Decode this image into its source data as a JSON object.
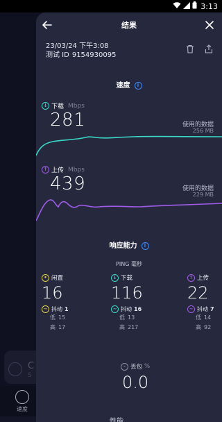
{
  "status_bar": {
    "time": "3:13"
  },
  "background_app": {
    "card_letter": "C",
    "card_sub": "S",
    "nav_label": "速度"
  },
  "header": {
    "title": "结果"
  },
  "test_meta": {
    "datetime": "23/03/24 下午3:08",
    "id_label": "测试 ID",
    "id_value": "9154930095"
  },
  "speed_section": {
    "title": "速度"
  },
  "download": {
    "label": "下载",
    "unit": "Mbps",
    "value": "281",
    "used_label": "使用的数据",
    "used_value": "256 MB",
    "color": "#3ad9c8"
  },
  "upload": {
    "label": "上传",
    "unit": "Mbps",
    "value": "439",
    "used_label": "使用的数据",
    "used_value": "229 MB",
    "color": "#a05ce8"
  },
  "responsiveness": {
    "title": "响应能力"
  },
  "ping": {
    "label": "PING 毫秒",
    "idle": {
      "label": "闲置",
      "value": "16",
      "jitter_label": "抖动",
      "jitter": "1",
      "low_label": "低",
      "low": "15",
      "high_label": "高",
      "high": "17",
      "color": "#e2d04a"
    },
    "download": {
      "label": "下载",
      "value": "116",
      "jitter_label": "抖动",
      "jitter": "16",
      "low_label": "低",
      "low": "13",
      "high_label": "高",
      "high": "217",
      "color": "#3ad9c8"
    },
    "upload": {
      "label": "上传",
      "value": "22",
      "jitter_label": "抖动",
      "jitter": "7",
      "low_label": "低",
      "low": "14",
      "high_label": "高",
      "high": "92",
      "color": "#a05ce8"
    }
  },
  "packet_loss": {
    "label": "丢包",
    "unit": "%",
    "value": "0.0"
  },
  "bottom_partial": "性能"
}
